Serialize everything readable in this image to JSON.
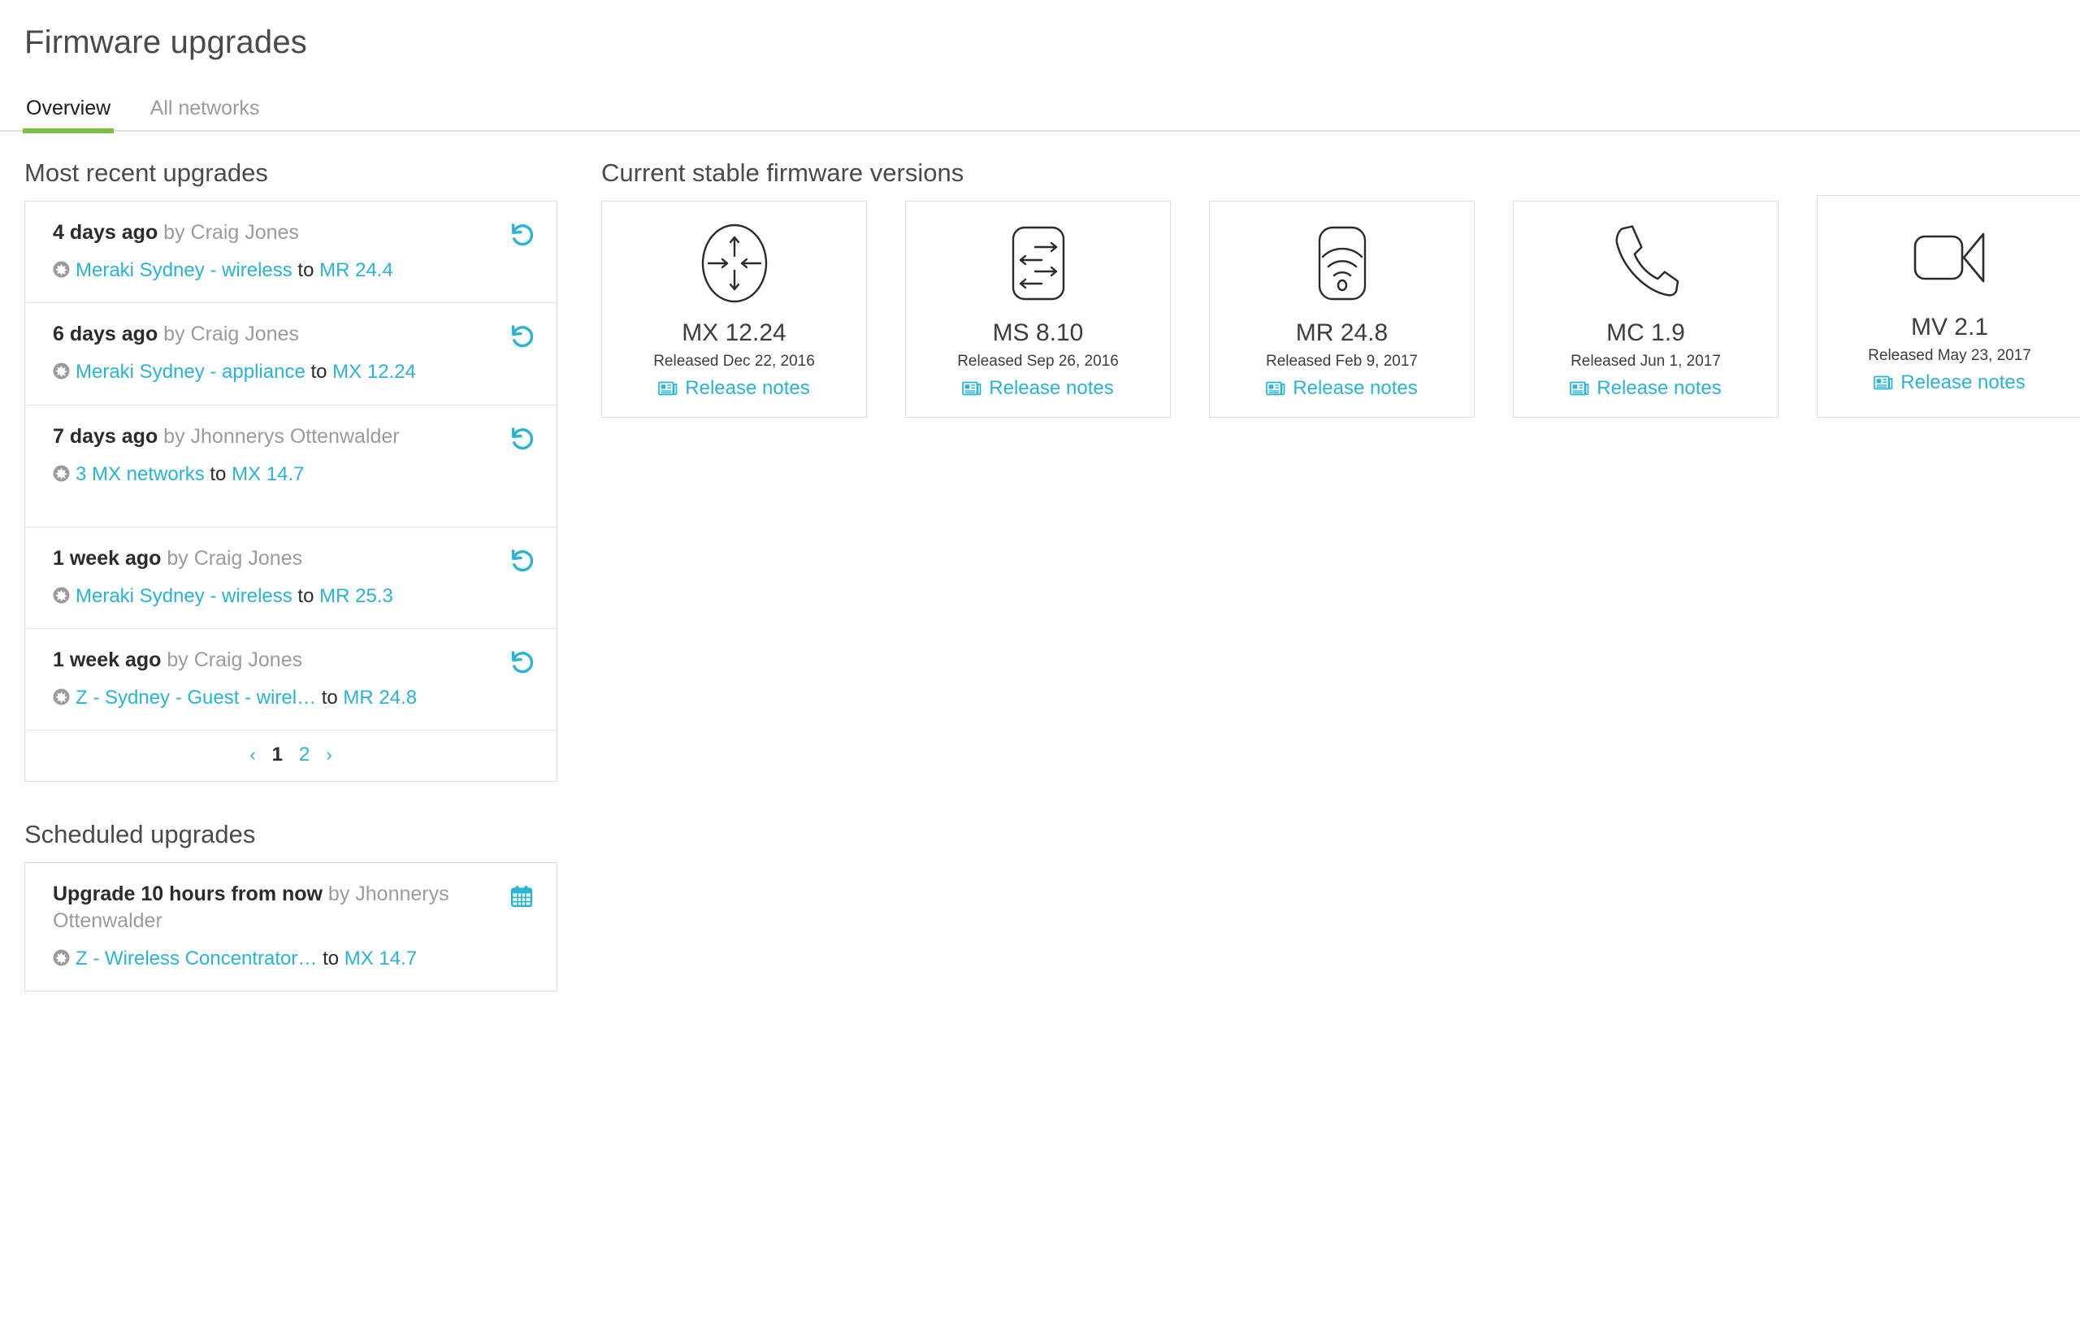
{
  "page": {
    "title": "Firmware upgrades"
  },
  "tabs": [
    {
      "label": "Overview",
      "active": true
    },
    {
      "label": "All networks",
      "active": false
    }
  ],
  "recent": {
    "heading": "Most recent upgrades",
    "items": [
      {
        "when": "4 days ago",
        "by": " by Craig Jones",
        "network": "Meraki Sydney - wireless",
        "to": " to ",
        "version": "MR 24.4",
        "action_icon": "rollback-icon"
      },
      {
        "when": "6 days ago",
        "by": " by Craig Jones",
        "network": "Meraki Sydney - appliance",
        "to": " to ",
        "version": "MX 12.24",
        "action_icon": "rollback-icon"
      },
      {
        "when": "7 days ago",
        "by": " by Jhonnerys Ottenwalder",
        "network": "3 MX networks",
        "to": " to ",
        "version": "MX 14.7",
        "action_icon": "rollback-icon"
      },
      {
        "when": "1 week ago",
        "by": " by Craig Jones",
        "network": "Meraki Sydney - wireless",
        "to": " to ",
        "version": "MR 25.3",
        "action_icon": "rollback-icon"
      },
      {
        "when": "1 week ago",
        "by": " by Craig Jones",
        "network": "Z - Sydney - Guest - wirel…",
        "to": "  to ",
        "version": "MR 24.8",
        "action_icon": "rollback-icon"
      }
    ],
    "pagination": {
      "prev": "‹",
      "pages": [
        "1",
        "2"
      ],
      "current": "1",
      "next": "›"
    }
  },
  "scheduled": {
    "heading": "Scheduled upgrades",
    "items": [
      {
        "when": "Upgrade 10 hours from now",
        "by": " by Jhonnerys Ottenwalder",
        "network": "Z - Wireless Concentrator…",
        "to": "  to ",
        "version": "MX 14.7",
        "action_icon": "calendar-icon"
      }
    ]
  },
  "firmware": {
    "heading": "Current stable firmware versions",
    "notes_label": "Release notes",
    "cards": [
      {
        "icon": "appliance-icon",
        "name": "MX 12.24",
        "released": "Released Dec 22, 2016"
      },
      {
        "icon": "switch-icon",
        "name": "MS 8.10",
        "released": "Released Sep 26, 2016"
      },
      {
        "icon": "wireless-icon",
        "name": "MR 24.8",
        "released": "Released Feb 9, 2017"
      },
      {
        "icon": "phone-icon",
        "name": "MC 1.9",
        "released": "Released Jun 1, 2017"
      },
      {
        "icon": "camera-icon",
        "name": "MV 2.1",
        "released": "Released May 23, 2017"
      }
    ]
  },
  "colors": {
    "link": "#27b4d6",
    "tab_active_underline": "#7ac143",
    "text_primary": "#2b2b2b",
    "text_muted": "#9b9b9b",
    "border": "#dddddd"
  }
}
